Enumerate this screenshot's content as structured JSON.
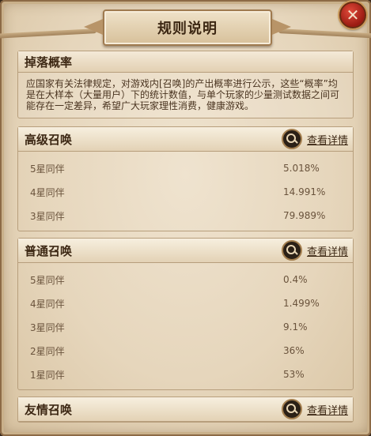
{
  "window": {
    "title": "规则说明"
  },
  "notice": {
    "heading": "掉落概率",
    "text": "应国家有关法律规定，对游戏内[召唤]的产出概率进行公示，这些“概率”均是在大样本（大量用户）下的统计数值，与单个玩家的少量测试数据之间可能存在一定差异，希望广大玩家理性消费，健康游戏。"
  },
  "sections": [
    {
      "title": "高级召唤",
      "details_label": "查看详情",
      "rows": [
        {
          "name": "5星同伴",
          "rate": "5.018%"
        },
        {
          "name": "4星同伴",
          "rate": "14.991%"
        },
        {
          "name": "3星同伴",
          "rate": "79.989%"
        }
      ]
    },
    {
      "title": "普通召唤",
      "details_label": "查看详情",
      "rows": [
        {
          "name": "5星同伴",
          "rate": "0.4%"
        },
        {
          "name": "4星同伴",
          "rate": "1.499%"
        },
        {
          "name": "3星同伴",
          "rate": "9.1%"
        },
        {
          "name": "2星同伴",
          "rate": "36%"
        },
        {
          "name": "1星同伴",
          "rate": "53%"
        }
      ]
    },
    {
      "title": "友情召唤",
      "details_label": "查看详情",
      "rows": []
    }
  ],
  "icons": {
    "close": "close-icon",
    "details": "magnifier-icon"
  },
  "colors": {
    "parchment": "#e6d6bc",
    "text_dark": "#3d2814",
    "close_red": "#c0301f"
  }
}
